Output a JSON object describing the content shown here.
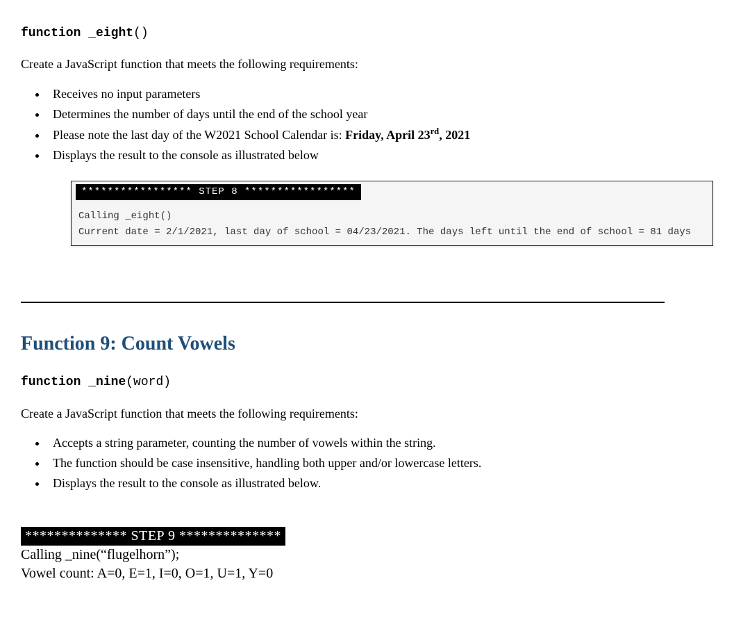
{
  "step8": {
    "signature": {
      "keyword": "function",
      "name": "_eight",
      "params": "()"
    },
    "intro": "Create a JavaScript function that meets the following requirements:",
    "bullets": {
      "b1": "Receives no input parameters",
      "b2": "Determines the number of days until the end of the school year",
      "b3_prefix": "Please note the last day of the W2021 School Calendar is: ",
      "b3_bold_pre": "Friday, April 23",
      "b3_bold_sup": "rd",
      "b3_bold_post": ", 2021",
      "b4": "Displays the result to the console as illustrated below"
    },
    "console": {
      "header": "***************** STEP 8 *****************",
      "line1": "Calling _eight()",
      "line2": "Current date = 2/1/2021, last day of school = 04/23/2021. The days left until the end of school = 81 days"
    }
  },
  "step9": {
    "heading": "Function 9: Count Vowels",
    "signature": {
      "keyword": "function",
      "name": "_nine",
      "params": "(word)"
    },
    "intro": "Create a JavaScript function that meets the following requirements:",
    "bullets": {
      "b1": "Accepts a string parameter, counting the number of vowels within the string.",
      "b2": "The function should be case insensitive, handling both upper and/or lowercase letters.",
      "b3": "Displays the result to the console as illustrated below."
    },
    "console": {
      "header": "************** STEP 9 **************",
      "line1": "Calling   _nine(“flugelhorn”);",
      "line2": "Vowel count: A=0, E=1, I=0, O=1, U=1, Y=0"
    }
  }
}
